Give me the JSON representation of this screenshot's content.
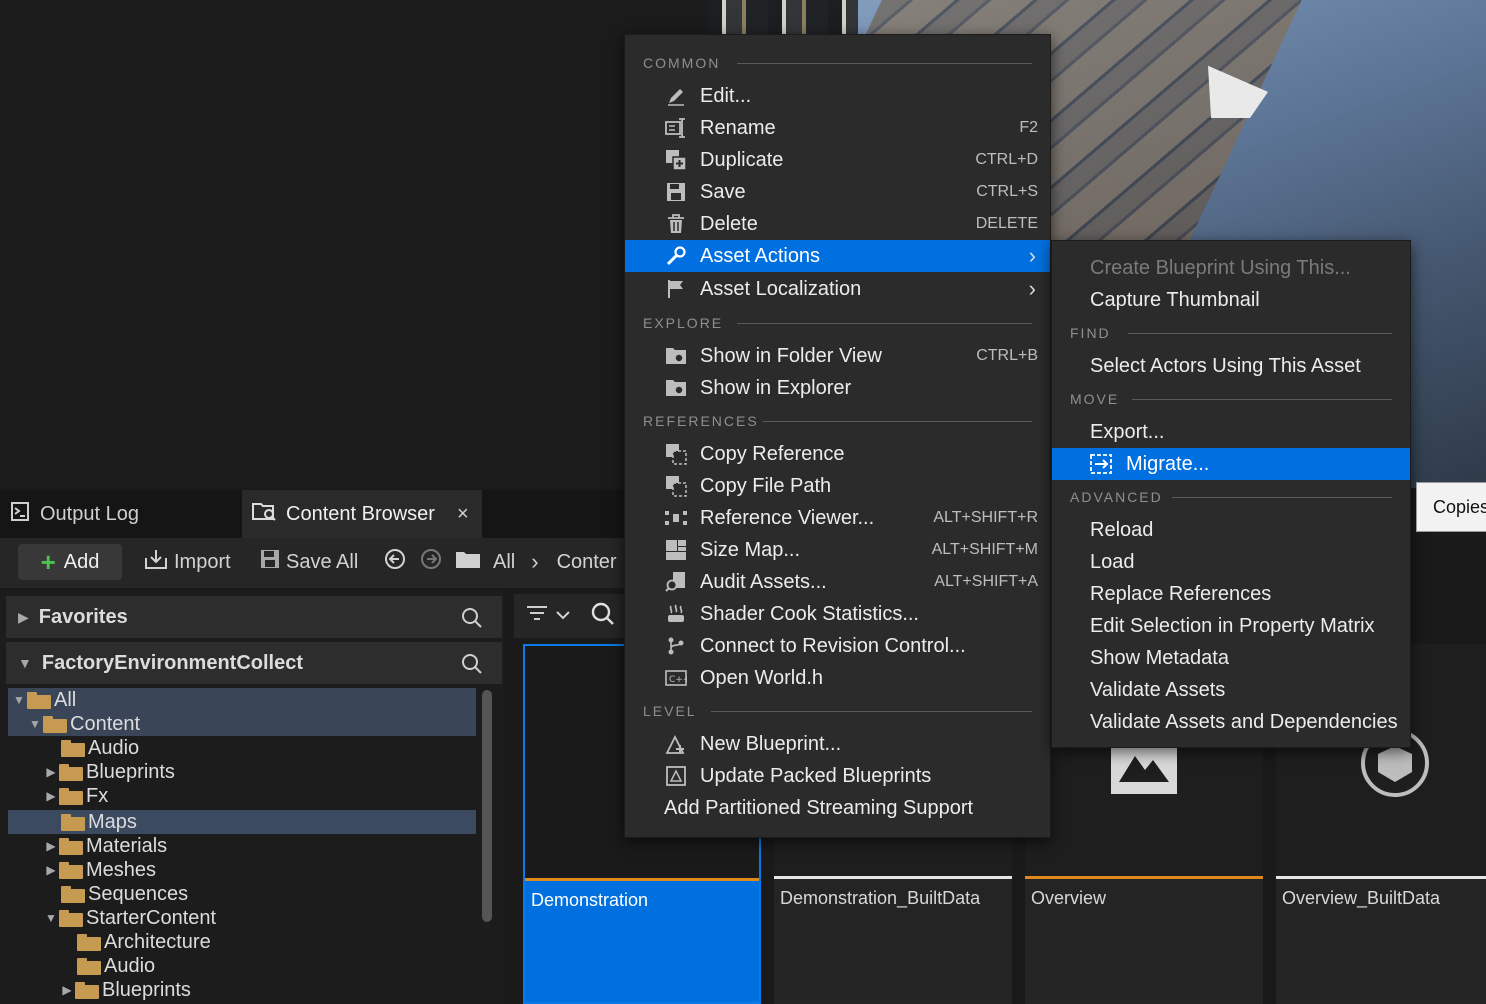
{
  "tabs": {
    "output_log": "Output Log",
    "content_browser": "Content Browser",
    "close_glyph": "×"
  },
  "toolbar": {
    "add": "Add",
    "import": "Import",
    "save_all": "Save All",
    "path_all": "All",
    "path_content": "Conter"
  },
  "panels": {
    "favorites": "Favorites",
    "collection": "FactoryEnvironmentCollect"
  },
  "tree": [
    {
      "label": "All",
      "expanded": true
    },
    {
      "label": "Content",
      "expanded": true
    },
    {
      "label": "Audio"
    },
    {
      "label": "Blueprints"
    },
    {
      "label": "Fx"
    },
    {
      "label": "Maps",
      "selected": true
    },
    {
      "label": "Materials"
    },
    {
      "label": "Meshes"
    },
    {
      "label": "Sequences"
    },
    {
      "label": "StarterContent",
      "expanded": true
    },
    {
      "label": "Architecture"
    },
    {
      "label": "Audio"
    },
    {
      "label": "Blueprints"
    }
  ],
  "assets": [
    {
      "name": "Demonstration",
      "selected": true
    },
    {
      "name": "Demonstration_BuiltData"
    },
    {
      "name": "Overview"
    },
    {
      "name": "Overview_BuiltData"
    }
  ],
  "menu": {
    "sections": {
      "common": "COMMON",
      "explore": "EXPLORE",
      "references": "REFERENCES",
      "level": "LEVEL"
    },
    "items": {
      "edit": "Edit...",
      "rename": "Rename",
      "rename_sc": "F2",
      "duplicate": "Duplicate",
      "duplicate_sc": "CTRL+D",
      "save": "Save",
      "save_sc": "CTRL+S",
      "delete": "Delete",
      "delete_sc": "DELETE",
      "asset_actions": "Asset Actions",
      "asset_localization": "Asset Localization",
      "show_folder": "Show in Folder View",
      "show_folder_sc": "CTRL+B",
      "show_explorer": "Show in Explorer",
      "copy_reference": "Copy Reference",
      "copy_file_path": "Copy File Path",
      "reference_viewer": "Reference Viewer...",
      "reference_viewer_sc": "ALT+SHIFT+R",
      "size_map": "Size Map...",
      "size_map_sc": "ALT+SHIFT+M",
      "audit_assets": "Audit Assets...",
      "audit_assets_sc": "ALT+SHIFT+A",
      "shader_cook": "Shader Cook Statistics...",
      "connect_revision": "Connect to Revision Control...",
      "open_world": "Open World.h",
      "new_blueprint": "New Blueprint...",
      "update_packed": "Update Packed Blueprints",
      "add_partitioned": "Add Partitioned Streaming Support"
    }
  },
  "submenu": {
    "sections": {
      "find": "FIND",
      "move": "MOVE",
      "advanced": "ADVANCED"
    },
    "items": {
      "create_blueprint": "Create Blueprint Using This...",
      "capture_thumbnail": "Capture Thumbnail",
      "select_actors": "Select Actors Using This Asset",
      "export": "Export...",
      "migrate": "Migrate...",
      "reload": "Reload",
      "load": "Load",
      "replace_references": "Replace References",
      "edit_property_matrix": "Edit Selection in Property Matrix",
      "show_metadata": "Show Metadata",
      "validate_assets": "Validate Assets",
      "validate_dependencies": "Validate Assets and Dependencies"
    }
  },
  "tooltip": "Copies",
  "colors": {
    "accent": "#0070e0",
    "folder": "#c79a51",
    "asset_bar_level": "#e08a1e",
    "asset_bar_data": "#e6e6e6"
  }
}
